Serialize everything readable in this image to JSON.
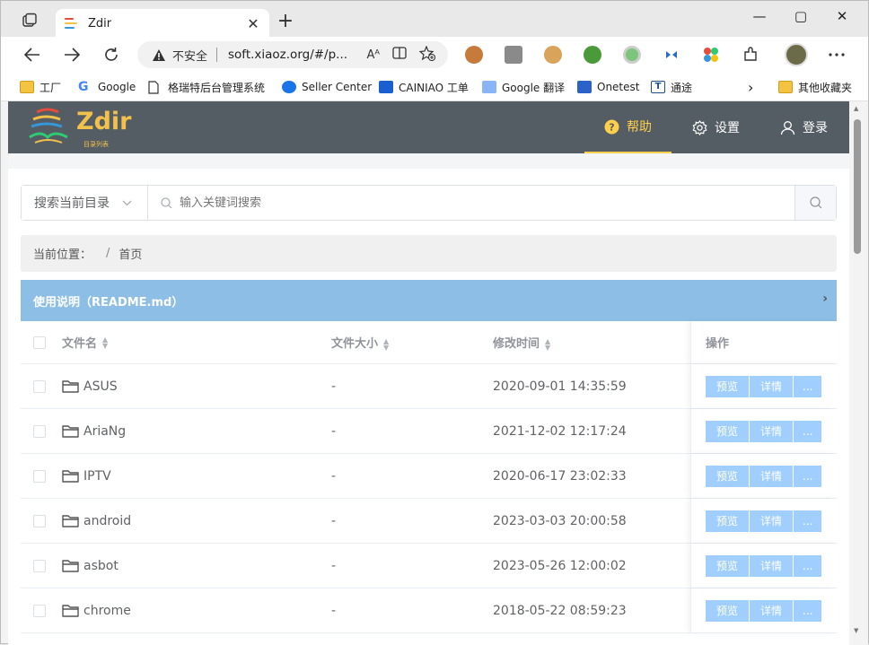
{
  "browser": {
    "tab_title": "Zdir",
    "tab_close": "✕",
    "new_tab": "+",
    "window_controls": {
      "minimize": "—",
      "maximize": "▢",
      "close": "✕"
    },
    "address": {
      "security_warning": "不安全",
      "url": "soft.xiaoz.org/#/p...",
      "read_aloud": "Aᴬ"
    },
    "favorites": [
      {
        "label": "工厂",
        "icon": "folder-icon"
      },
      {
        "label": "Google",
        "icon": "google-icon"
      },
      {
        "label": "格瑞特后台管理系统",
        "icon": "page-icon"
      },
      {
        "label": "Seller Center",
        "icon": "seller-icon"
      },
      {
        "label": "CAINIAO 工单",
        "icon": "cainiao-icon"
      },
      {
        "label": "Google 翻译",
        "icon": "translate-icon"
      },
      {
        "label": "Onetest",
        "icon": "dsm-icon"
      },
      {
        "label": "通途",
        "icon": "tongtu-icon"
      }
    ],
    "favorites_more": "›",
    "other_favorites": "其他收藏夹"
  },
  "app": {
    "logo_text": "Zdir",
    "logo_sub": "目录列表",
    "nav": {
      "help": "帮助",
      "settings": "设置",
      "login": "登录"
    },
    "search": {
      "scope": "搜索当前目录",
      "placeholder": "输入关键词搜索"
    },
    "breadcrumb": {
      "label": "当前位置：",
      "separator": "/",
      "home": "首页"
    },
    "readme": {
      "title": "使用说明（README.md）",
      "chevron": "›"
    },
    "table": {
      "headers": {
        "name": "文件名",
        "size": "文件大小",
        "time": "修改时间",
        "ops": "操作"
      },
      "rows": [
        {
          "name": "ASUS",
          "size": "-",
          "time": "2020-09-01 14:35:59"
        },
        {
          "name": "AriaNg",
          "size": "-",
          "time": "2021-12-02 12:17:24"
        },
        {
          "name": "IPTV",
          "size": "-",
          "time": "2020-06-17 23:02:33"
        },
        {
          "name": "android",
          "size": "-",
          "time": "2023-03-03 20:00:58"
        },
        {
          "name": "asbot",
          "size": "-",
          "time": "2023-05-26 12:00:02"
        },
        {
          "name": "chrome",
          "size": "-",
          "time": "2018-05-22 08:59:23"
        }
      ],
      "op_labels": {
        "preview": "预览",
        "detail": "详情",
        "more": "..."
      }
    }
  },
  "colors": {
    "header_bg": "#545c64",
    "accent": "#ffd04b",
    "readme_bg": "#8cbee6",
    "op_button": "#a0cfff"
  }
}
